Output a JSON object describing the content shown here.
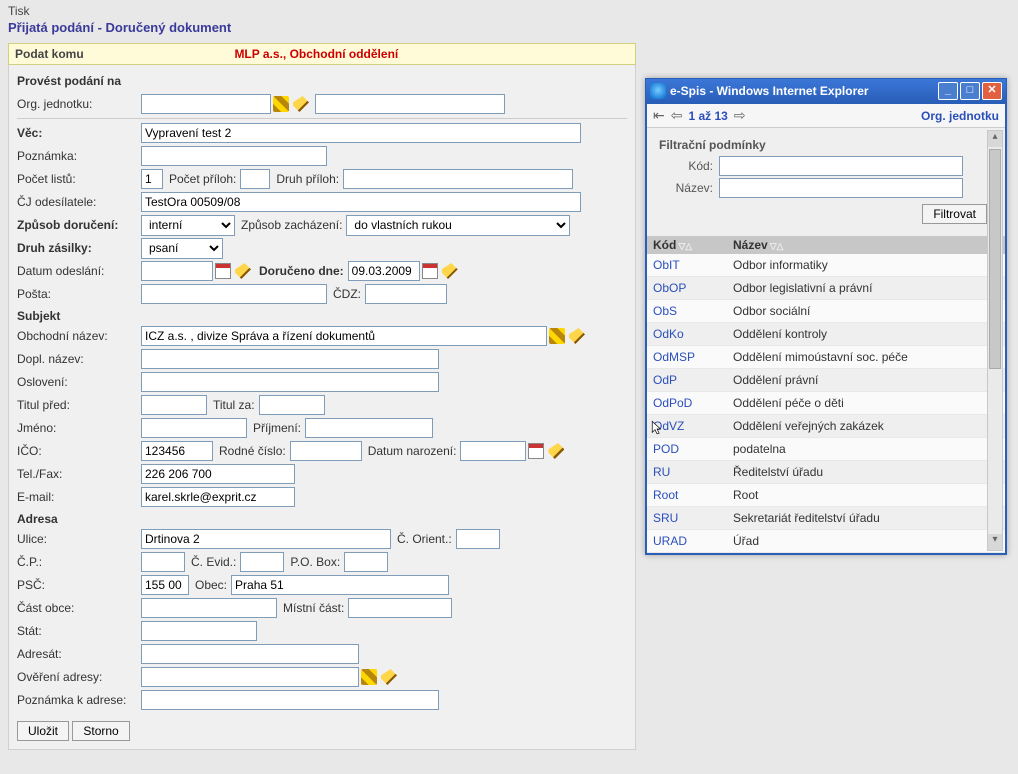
{
  "header": {
    "small": "Tisk",
    "main": "Přijatá podání - Doručený dokument"
  },
  "bar": {
    "left": "Podat komu",
    "right": "MLP a.s., Obchodní oddělení"
  },
  "form": {
    "provest_label": "Provést podání na",
    "org_jednotku": "Org. jednotku:",
    "vec_label": "Věc:",
    "vec_value": "Vypravení test 2",
    "poznamka_label": "Poznámka:",
    "pocet_listu_label": "Počet listů:",
    "pocet_listu_value": "1",
    "pocet_priloh_label": "Počet příloh:",
    "druh_priloh_label": "Druh příloh:",
    "cj_label": "ČJ odesílatele:",
    "cj_value": "TestOra 00509/08",
    "zpusob_doruceni_label": "Způsob doručení:",
    "zpusob_doruceni_value": "interní",
    "zpusob_zachazeni_label": "Způsob zacházení:",
    "zpusob_zachazeni_value": "do vlastních rukou",
    "druh_zasilky_label": "Druh zásilky:",
    "druh_zasilky_value": "psaní",
    "datum_odeslani_label": "Datum odeslání:",
    "doruceno_dne_label": "Doručeno dne:",
    "doruceno_dne_value": "09.03.2009",
    "posta_label": "Pošta:",
    "cdz_label": "ČDZ:",
    "subjekt": "Subjekt",
    "obch_nazev_label": "Obchodní název:",
    "obch_nazev_value": "ICZ a.s. , divize Správa a řízení dokumentů",
    "dopl_nazev_label": "Dopl. název:",
    "osloveni_label": "Oslovení:",
    "titul_pred_label": "Titul před:",
    "titul_za_label": "Titul za:",
    "jmeno_label": "Jméno:",
    "prijmeni_label": "Příjmení:",
    "ico_label": "IČO:",
    "ico_value": "123456",
    "rodne_cislo_label": "Rodné číslo:",
    "datum_narozeni_label": "Datum narození:",
    "tel_label": "Tel./Fax:",
    "tel_value": "226 206 700",
    "email_label": "E-mail:",
    "email_value": "karel.skrle@exprit.cz",
    "adresa": "Adresa",
    "ulice_label": "Ulice:",
    "ulice_value": "Drtinova 2",
    "c_orient_label": "Č. Orient.:",
    "cp_label": "Č.P.:",
    "c_evid_label": "Č. Evid.:",
    "po_box_label": "P.O. Box:",
    "psc_label": "PSČ:",
    "psc_value": "155 00",
    "obec_label": "Obec:",
    "obec_value": "Praha 51",
    "cast_obce_label": "Část obce:",
    "mistni_cast_label": "Místní část:",
    "stat_label": "Stát:",
    "adresat_label": "Adresát:",
    "overeni_label": "Ověření adresy:",
    "pozn_adresa_label": "Poznámka k adrese:"
  },
  "buttons": {
    "save": "Uložit",
    "cancel": "Storno"
  },
  "popup": {
    "title": "e-Spis - Windows Internet Explorer",
    "nav_text": "1 až 13",
    "nav_right": "Org. jednotku",
    "filter_title": "Filtrační podmínky",
    "kod_label": "Kód:",
    "nazev_label": "Název:",
    "filter_btn": "Filtrovat",
    "hdr_kod": "Kód",
    "hdr_nazev": "Název",
    "rows": [
      {
        "k": "ObIT",
        "n": "Odbor informatiky"
      },
      {
        "k": "ObOP",
        "n": "Odbor legislativní a právní"
      },
      {
        "k": "ObS",
        "n": "Odbor sociální"
      },
      {
        "k": "OdKo",
        "n": "Oddělení kontroly"
      },
      {
        "k": "OdMSP",
        "n": "Oddělení mimoústavní soc. péče"
      },
      {
        "k": "OdP",
        "n": "Oddělení právní"
      },
      {
        "k": "OdPoD",
        "n": "Oddělení péče o děti"
      },
      {
        "k": "OdVZ",
        "n": "Oddělení veřejných zakázek"
      },
      {
        "k": "POD",
        "n": "podatelna"
      },
      {
        "k": "RU",
        "n": "Ředitelství úřadu"
      },
      {
        "k": "Root",
        "n": "Root"
      },
      {
        "k": "SRU",
        "n": "Sekretariát ředitelství úřadu"
      },
      {
        "k": "URAD",
        "n": "Úřad"
      }
    ]
  }
}
